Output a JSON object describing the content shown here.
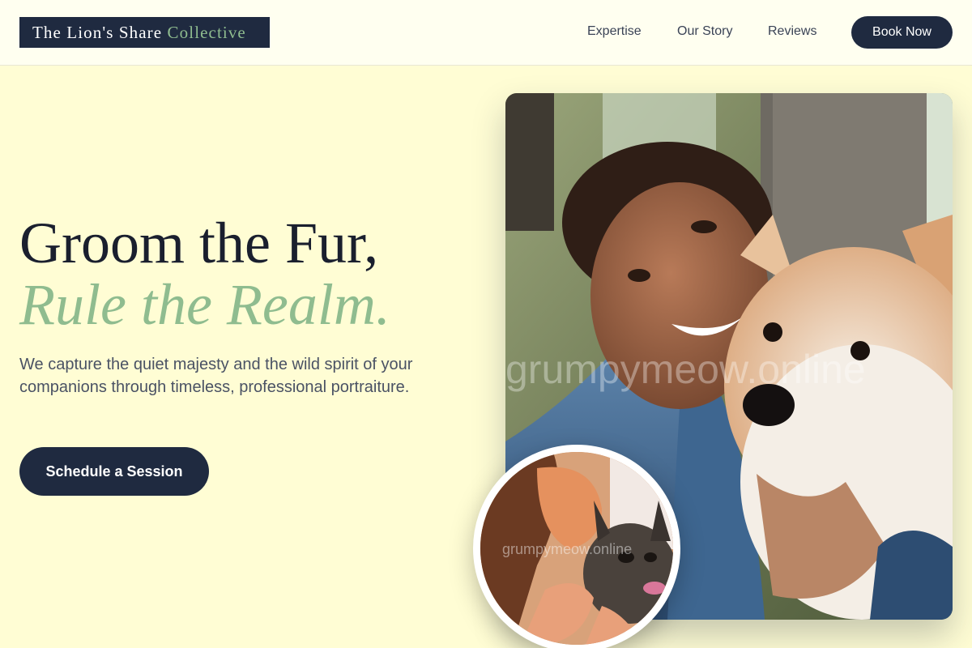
{
  "nav": {
    "logo_main": "The Lion's Share",
    "logo_accent": "Collective",
    "links": [
      "Expertise",
      "Our Story",
      "Reviews"
    ],
    "cta": "Book Now"
  },
  "hero": {
    "title_line1": "Groom the Fur,",
    "title_line2": "Rule the Realm.",
    "subtitle": "We capture the quiet majesty and the wild spirit of your companions through timeless, professional portraiture.",
    "cta": "Schedule a Session"
  },
  "images": {
    "main_watermark": "grumpymeow.online",
    "inset_watermark": "grumpymeow.online"
  },
  "colors": {
    "background": "#fffdd4",
    "navy": "#1f2a40",
    "sage_accent": "#8fbc8f"
  }
}
